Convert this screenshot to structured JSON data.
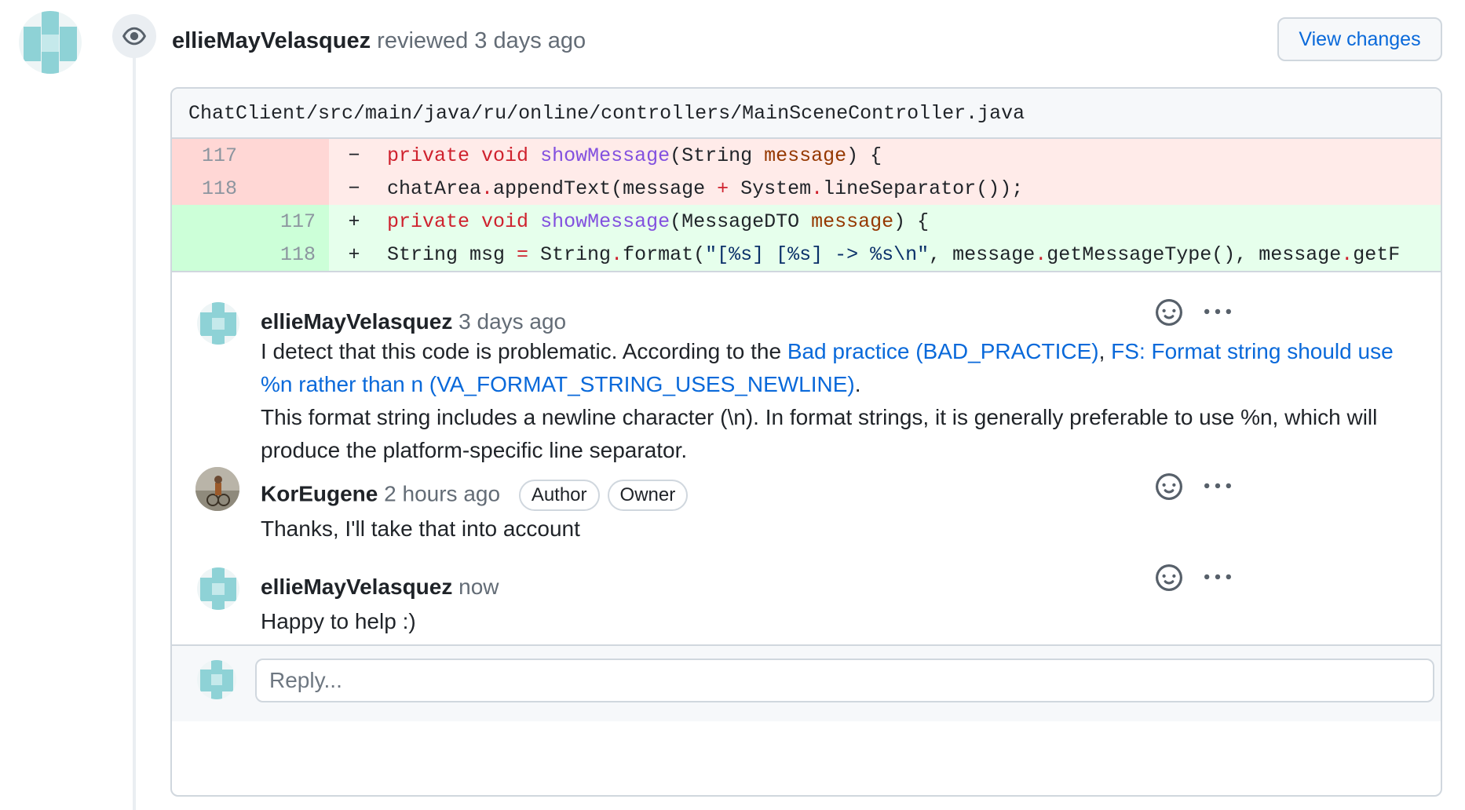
{
  "review": {
    "author": "ellieMayVelasquez",
    "action": "reviewed",
    "time": "3 days ago",
    "view_changes_label": "View changes"
  },
  "file": {
    "path": "ChatClient/src/main/java/ru/online/controllers/MainSceneController.java"
  },
  "diff": {
    "lines": [
      {
        "type": "del",
        "old": "117",
        "new": "",
        "sign": "−"
      },
      {
        "type": "del",
        "old": "118",
        "new": "",
        "sign": "−"
      },
      {
        "type": "add",
        "old": "",
        "new": "117",
        "sign": "+"
      },
      {
        "type": "add",
        "old": "",
        "new": "118",
        "sign": "+"
      }
    ]
  },
  "comments": [
    {
      "author": "ellieMayVelasquez",
      "time": "3 days ago",
      "body_intro": "I detect that this code is problematic. According to the ",
      "link1": "Bad practice (BAD_PRACTICE)",
      "sep": ", ",
      "link2": "FS: Format string should use %n rather than n (VA_FORMAT_STRING_USES_NEWLINE)",
      "end": ".",
      "body_rest": "This format string includes a newline character (\\n). In format strings, it is generally preferable to use %n, which will produce the platform-specific line separator."
    },
    {
      "author": "KorEugene",
      "time": "2 hours ago",
      "badges": [
        "Author",
        "Owner"
      ],
      "body": "Thanks, I'll take that into account"
    },
    {
      "author": "ellieMayVelasquez",
      "time": "now",
      "body": "Happy to help :)"
    }
  ],
  "reply": {
    "placeholder": "Reply..."
  },
  "icons": {
    "review": "eye-icon",
    "reaction": "smiley-icon",
    "more": "kebab-horizontal-icon"
  },
  "colors": {
    "link": "#0969da",
    "deleted_bg": "#ffebe9",
    "added_bg": "#e6ffec"
  }
}
